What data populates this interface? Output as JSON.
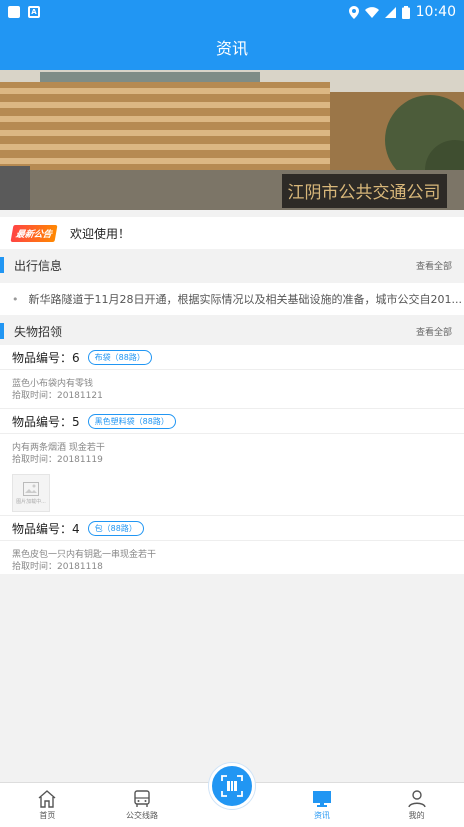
{
  "status_bar": {
    "time": "10:40",
    "icons": [
      "notification-square-icon",
      "notification-a-icon",
      "location-icon",
      "wifi-icon",
      "signal-icon",
      "battery-icon"
    ]
  },
  "app_bar": {
    "title": "资讯"
  },
  "banner": {
    "sign_text": "江阴市公共交通公司"
  },
  "notice": {
    "badge": "最新公告",
    "text": "欢迎使用！"
  },
  "travel_info": {
    "title": "出行信息",
    "view_all": "查看全部",
    "items": [
      {
        "text": "新华路隧道于11月28日开通，根据实际情况以及相关基础设施的准备，城市公交自201..."
      }
    ]
  },
  "lost_found": {
    "title": "失物招领",
    "view_all": "查看全部",
    "items": [
      {
        "number": "物品编号：6",
        "tag": "布袋（88路）",
        "desc": "蓝色小布袋内有零钱",
        "time": "拾取时间：20181121"
      },
      {
        "number": "物品编号：5",
        "tag": "黑色塑料袋（88路）",
        "desc": "内有两条烟酒 现金若干",
        "time": "拾取时间：20181119",
        "photo_caption": "图片加载中..."
      },
      {
        "number": "物品编号：4",
        "tag": "包（88路）",
        "desc": "黑色皮包一只内有钥匙一串现金若干",
        "time": "拾取时间：20181118"
      }
    ]
  },
  "tab_bar": {
    "tabs": [
      {
        "label": "首页",
        "icon": "home-icon"
      },
      {
        "label": "公交线路",
        "icon": "bus-icon"
      },
      {
        "label": "资讯",
        "icon": "monitor-icon",
        "active": true
      },
      {
        "label": "我的",
        "icon": "user-icon"
      }
    ],
    "center_button_icon": "qr-scan-icon"
  },
  "colors": {
    "primary": "#2196f3",
    "background": "#f2f2f2"
  }
}
